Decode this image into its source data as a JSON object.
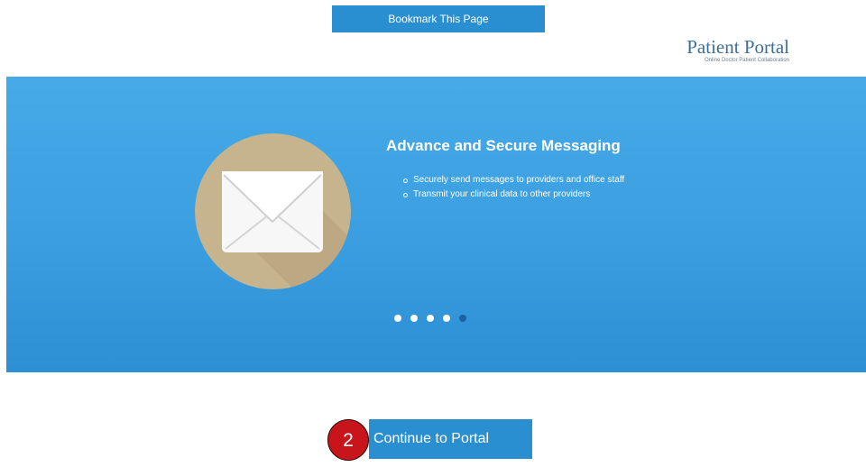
{
  "header": {
    "bookmark_label": "Bookmark This Page",
    "logo_title": "Patient Portal",
    "logo_tagline": "Online Doctor Patient Collaboration"
  },
  "carousel": {
    "slide_title": "Advance and Secure Messaging",
    "features": [
      "Securely send messages to providers and office staff",
      "Transmit your clinical data to other providers"
    ],
    "icon": "envelope-icon",
    "slide_count": 5,
    "active_slide": 5
  },
  "footer": {
    "continue_label": "Continue to Portal",
    "step_badge": "2"
  },
  "colors": {
    "accent": "#2a8fd0",
    "hero": "#3a9ee0",
    "circle": "#c6b48e",
    "badge": "#c8151b",
    "active_dot": "#1f5fa5"
  }
}
